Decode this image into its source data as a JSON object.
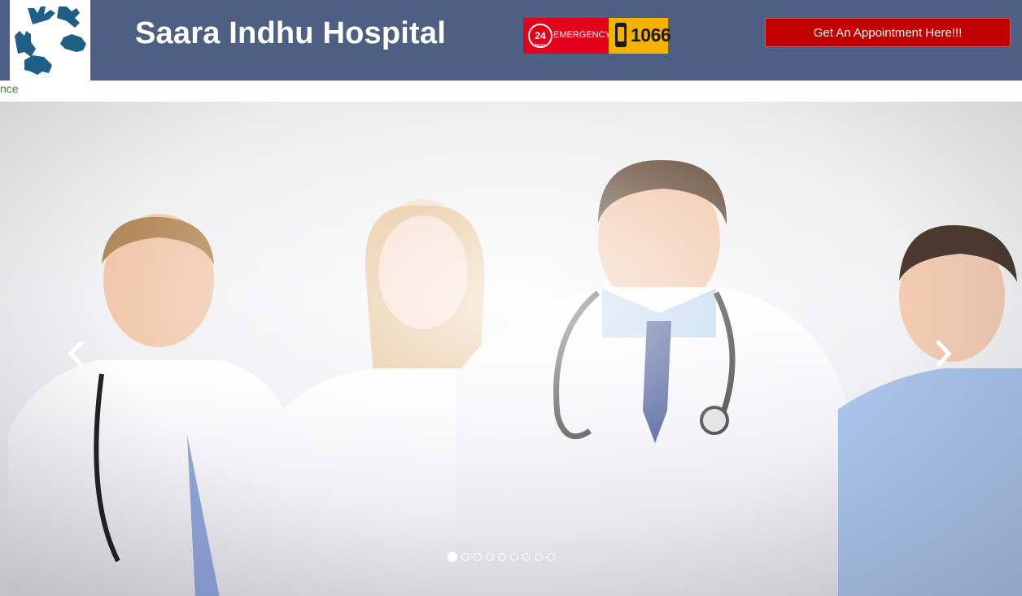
{
  "header": {
    "title": "Saara Indhu Hospital",
    "logo_icon": "helping-hands-logo-icon",
    "brand_color": "#4d5f82"
  },
  "emergency": {
    "badge_24": "24",
    "badge_hrs": "hours",
    "label": "EMERGENCY",
    "number": "1066"
  },
  "appointment": {
    "label": "Get An Appointment Here!!!"
  },
  "ticker": {
    "text": "nce"
  },
  "carousel": {
    "prev_icon": "chevron-left-icon",
    "next_icon": "chevron-right-icon",
    "slide_count": 9,
    "active_index": 0
  }
}
